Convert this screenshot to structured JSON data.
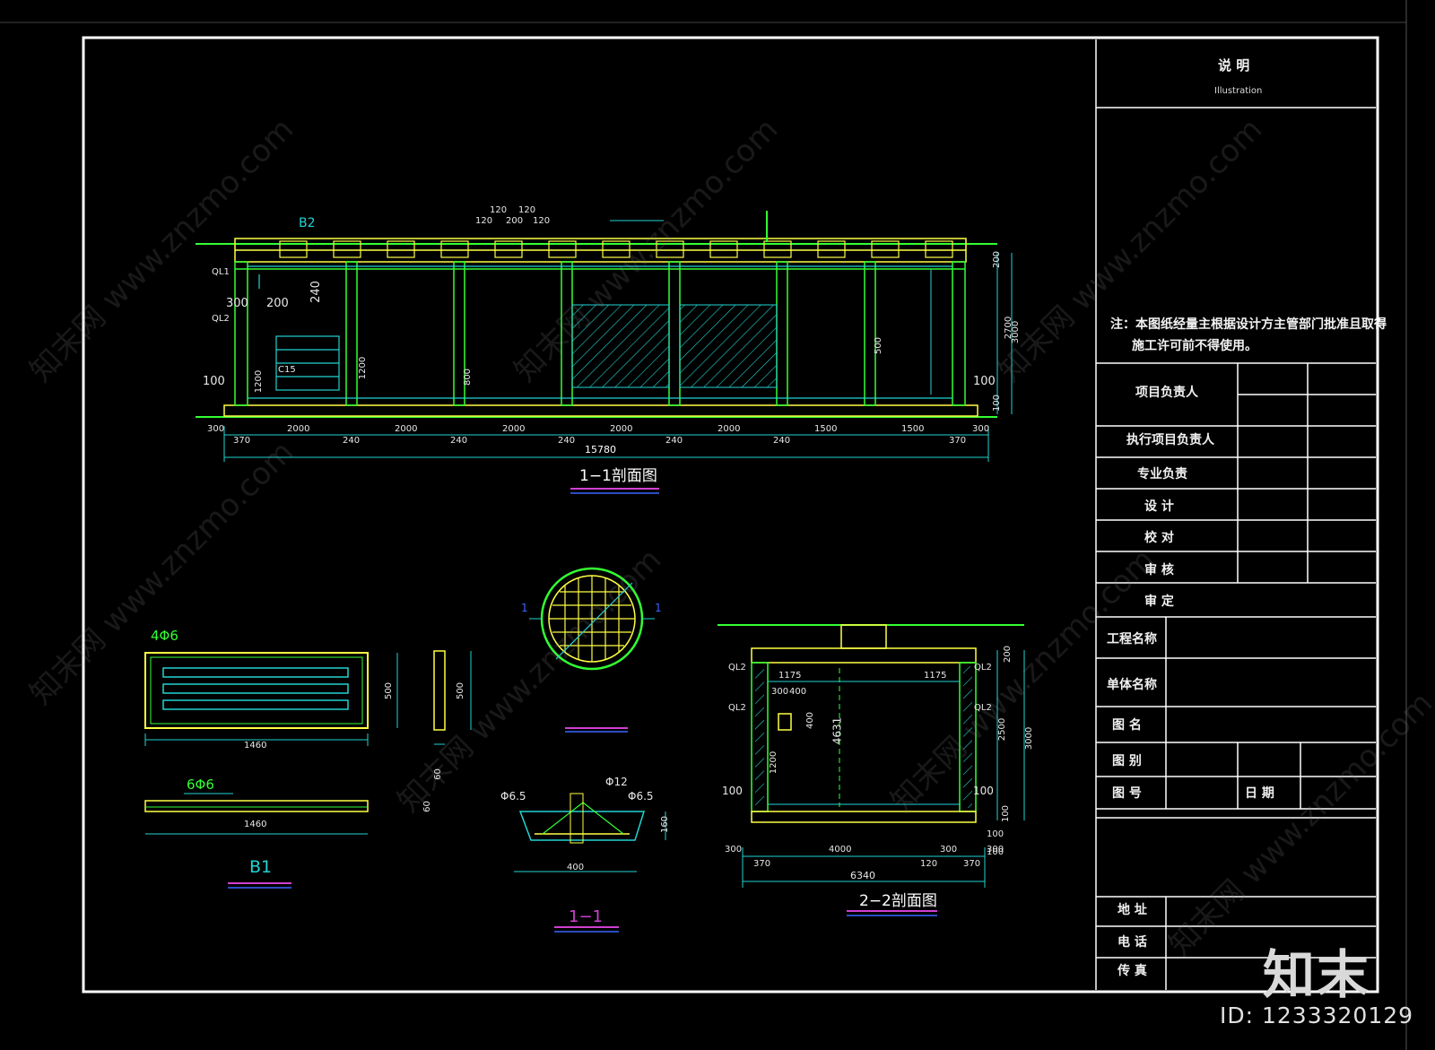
{
  "title_block": {
    "header": "说 明",
    "header_en": "Illustration",
    "note_line1": "注：本图纸经量主根据设计方主管部门批准且取得",
    "note_line2": "施工许可前不得使用。",
    "rows": [
      "项目负责人",
      "执行项目负责人",
      "专业负责",
      "设 计",
      "校 对",
      "审 核",
      "审 定"
    ],
    "project_name": "工程名称",
    "unit_name": "单体名称",
    "drawing_name": "图 名",
    "scale": "图 别",
    "drawing_no": "图 号",
    "date": "日 期",
    "address": "地 址",
    "phone": "电 话",
    "fax": "传 真"
  },
  "section_1_1": {
    "title": "1−1剖面图",
    "dims_top": [
      "120",
      "120",
      "120",
      "200",
      "120"
    ],
    "dims_bottom": [
      "300",
      "370",
      "2000",
      "240",
      "2000",
      "240",
      "2000",
      "240",
      "2000",
      "240",
      "2000",
      "240",
      "1500",
      "1500",
      "370",
      "300"
    ],
    "total": "15780",
    "labels": [
      "B2",
      "QL1",
      "QL2",
      "300",
      "200",
      "240",
      "100",
      "100",
      "C15"
    ],
    "right_dims": [
      "200",
      "2700",
      "3000",
      "100"
    ],
    "vertical_dims": [
      "1200",
      "800",
      "1200",
      "500"
    ]
  },
  "detail_b1": {
    "title": "B1",
    "rebar_top": "4Φ6",
    "rebar_bottom": "6Φ6",
    "width": "1460",
    "width2": "1460",
    "height": "500",
    "height2": "500",
    "thickness": "60",
    "thickness2": "60"
  },
  "manhole": {
    "section_marks": [
      "1",
      "1"
    ],
    "detail_title": "1−1",
    "labels": [
      "Φ6.5",
      "Φ6.5",
      "Φ12"
    ],
    "dim": "400",
    "height": "160"
  },
  "section_2_2": {
    "title": "2−2剖面图",
    "labels": [
      "QL2",
      "QL2",
      "QL2",
      "QL2",
      "1175",
      "1175",
      "300",
      "400",
      "400",
      "1200",
      "4631",
      "100",
      "100"
    ],
    "dims_bottom": [
      "300",
      "370",
      "4000",
      "120",
      "300",
      "370",
      "300"
    ],
    "total": "6340",
    "right_dims": [
      "200",
      "2500",
      "3000",
      "100",
      "100",
      "100"
    ]
  },
  "watermark": "知末网 www.znzmo.com",
  "brand": "知末",
  "id_text": "ID: 1233320129",
  "colors": {
    "background": "#000000",
    "frame": "#ffffff",
    "cyan": "#22d3d3",
    "green": "#33ff33",
    "yellow": "#ffff44",
    "magenta": "#d040d0",
    "blue": "#3a66ff"
  }
}
